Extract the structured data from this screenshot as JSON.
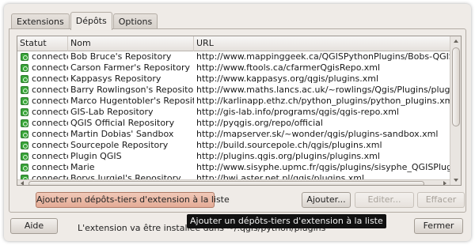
{
  "tabs": [
    {
      "label": "Extensions",
      "active": false
    },
    {
      "label": "Dépôts",
      "active": true
    },
    {
      "label": "Options",
      "active": false
    }
  ],
  "table": {
    "columns": [
      "Statut",
      "Nom",
      "URL"
    ],
    "rows": [
      {
        "status": "connecté",
        "name": "Bob Bruce's Repository",
        "url": "http://www.mappinggeek.ca/QGISPythonPlugins/Bobs-QGIS-plugins"
      },
      {
        "status": "connecté",
        "name": "Carson Farmer's Repository",
        "url": "http://www.ftools.ca/cfarmerQgisRepo.xml"
      },
      {
        "status": "connecté",
        "name": "Kappasys Repository",
        "url": "http://www.kappasys.org/qgis/plugins.xml"
      },
      {
        "status": "connecté",
        "name": "Barry Rowlingson's Repository",
        "url": "http://www.maths.lancs.ac.uk/~rowlings/Qgis/Plugins/plugins.xml"
      },
      {
        "status": "connecté",
        "name": "Marco Hugentobler's Repository",
        "url": "http://karlinapp.ethz.ch/python_plugins/python_plugins.xml"
      },
      {
        "status": "connecté",
        "name": "GIS-Lab Repository",
        "url": "http://gis-lab.info/programs/qgis/qgis-repo.xml"
      },
      {
        "status": "connecté",
        "name": "QGIS Official Repository",
        "url": "http://pyqgis.org/repo/official"
      },
      {
        "status": "connecté",
        "name": "Martin Dobias' Sandbox",
        "url": "http://mapserver.sk/~wonder/qgis/plugins-sandbox.xml"
      },
      {
        "status": "connecté",
        "name": "Sourcepole Repository",
        "url": "http://build.sourcepole.ch/qgis/plugins.xml"
      },
      {
        "status": "connecté",
        "name": "Plugin QGIS",
        "url": "http://plugins.qgis.org/plugins/plugins.xml"
      },
      {
        "status": "connecté",
        "name": "Marie",
        "url": "http://www.sisyphe.upmc.fr/qgis/plugins/sisyphe_QGISPlugins.xml"
      },
      {
        "status": "connecté",
        "name": "Borys Jurgiel's Repository",
        "url": "http://bwj.aster.net.pl/qgis/plugins.xml"
      }
    ]
  },
  "buttons": {
    "add_third_party": "Ajouter un dépôts-tiers d'extension à la liste",
    "add": "Ajouter...",
    "edit": "Editer...",
    "delete": "Effacer",
    "help": "Aide",
    "close": "Fermer"
  },
  "tooltip": "Ajouter un dépôts-tiers d'extension à la liste",
  "status_message": "L'extension va être installée dans ~/.qgis/python/plugins",
  "colors": {
    "window_bg": "#efebe7",
    "status_icon": "#3aa53a",
    "hover_button": "#e4ab96",
    "tooltip_bg": "#111111"
  }
}
